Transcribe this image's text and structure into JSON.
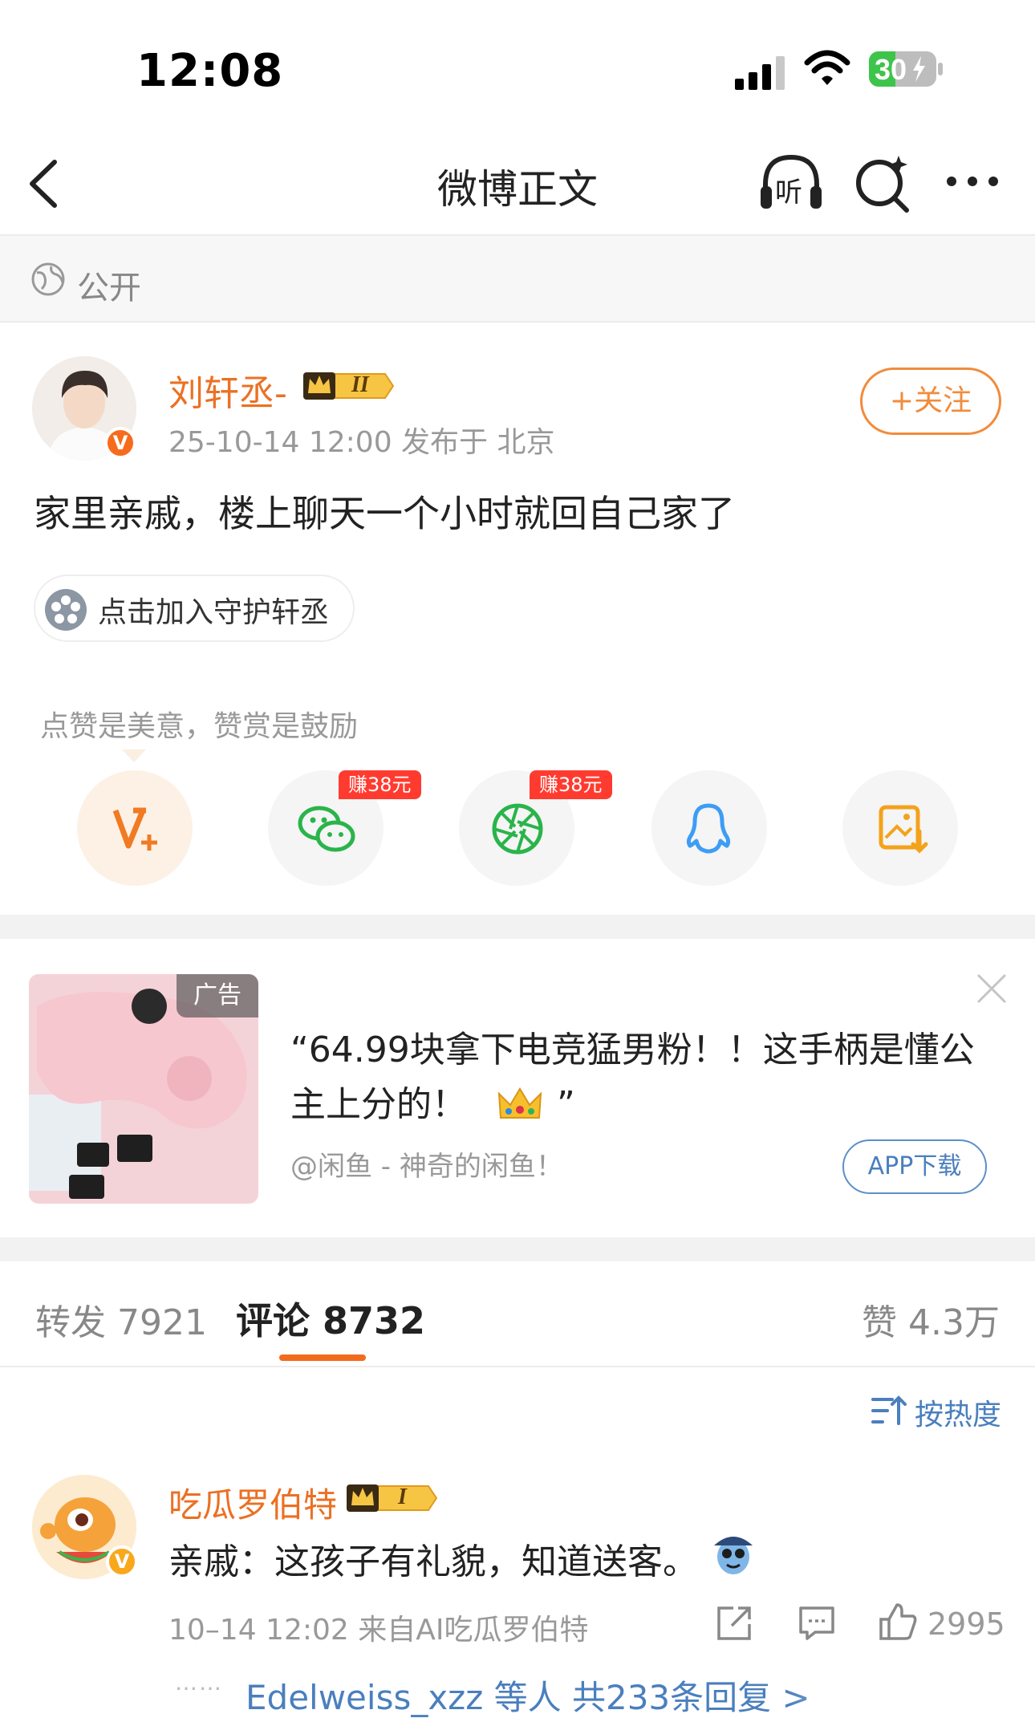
{
  "status_bar": {
    "time": "12:08",
    "battery": "30"
  },
  "nav": {
    "title": "微博正文",
    "listen_label": "听"
  },
  "visibility": {
    "label": "公开"
  },
  "post": {
    "author": "刘轩丞-",
    "author_level": "II",
    "avatar_badge": "V",
    "meta": "25-10-14 12:00  发布于 北京",
    "follow_label": "+关注",
    "text": "家里亲戚，楼上聊天一个小时就回自己家了",
    "guard_label": "点击加入守护轩丞"
  },
  "share": {
    "hint": "点赞是美意，赞赏是鼓励",
    "items": [
      {
        "name": "reward",
        "icon": "weibo-v-plus-icon"
      },
      {
        "name": "wechat",
        "icon": "wechat-icon",
        "badge": "赚38元"
      },
      {
        "name": "moments",
        "icon": "camera-aperture-icon",
        "badge": "赚38元"
      },
      {
        "name": "qq",
        "icon": "qq-penguin-icon"
      },
      {
        "name": "save-image",
        "icon": "save-image-icon"
      }
    ],
    "colors": {
      "reward": "#f07b22",
      "wechat": "#2ab44a",
      "qq": "#3d9df5",
      "save": "#f4a21b",
      "earn_badge": "#ff3b30"
    }
  },
  "ad": {
    "tag": "广告",
    "title_line1": "“64.99块拿下电竞猛男粉！！这手柄是懂公",
    "title_line2": "主上分的！",
    "title_close_quote": "”",
    "source": "@闲鱼 - 神奇的闲鱼！",
    "button": "APP下载"
  },
  "tabs": {
    "repost": "转发 7921",
    "comment": "评论 8732",
    "like": "赞 4.3万",
    "accent": "#f26b1d"
  },
  "sort": {
    "label": "按热度"
  },
  "comment": {
    "user": "吃瓜罗伯特",
    "user_level": "I",
    "avatar_badge": "V",
    "text": "亲戚：这孩子有礼貌，知道送客。",
    "meta": "10–14 12:02  来自AI吃瓜罗伯特",
    "like_count": "2995",
    "replies_dots": "……",
    "replies": "Edelweiss_xzz 等人  共233条回复 >"
  }
}
